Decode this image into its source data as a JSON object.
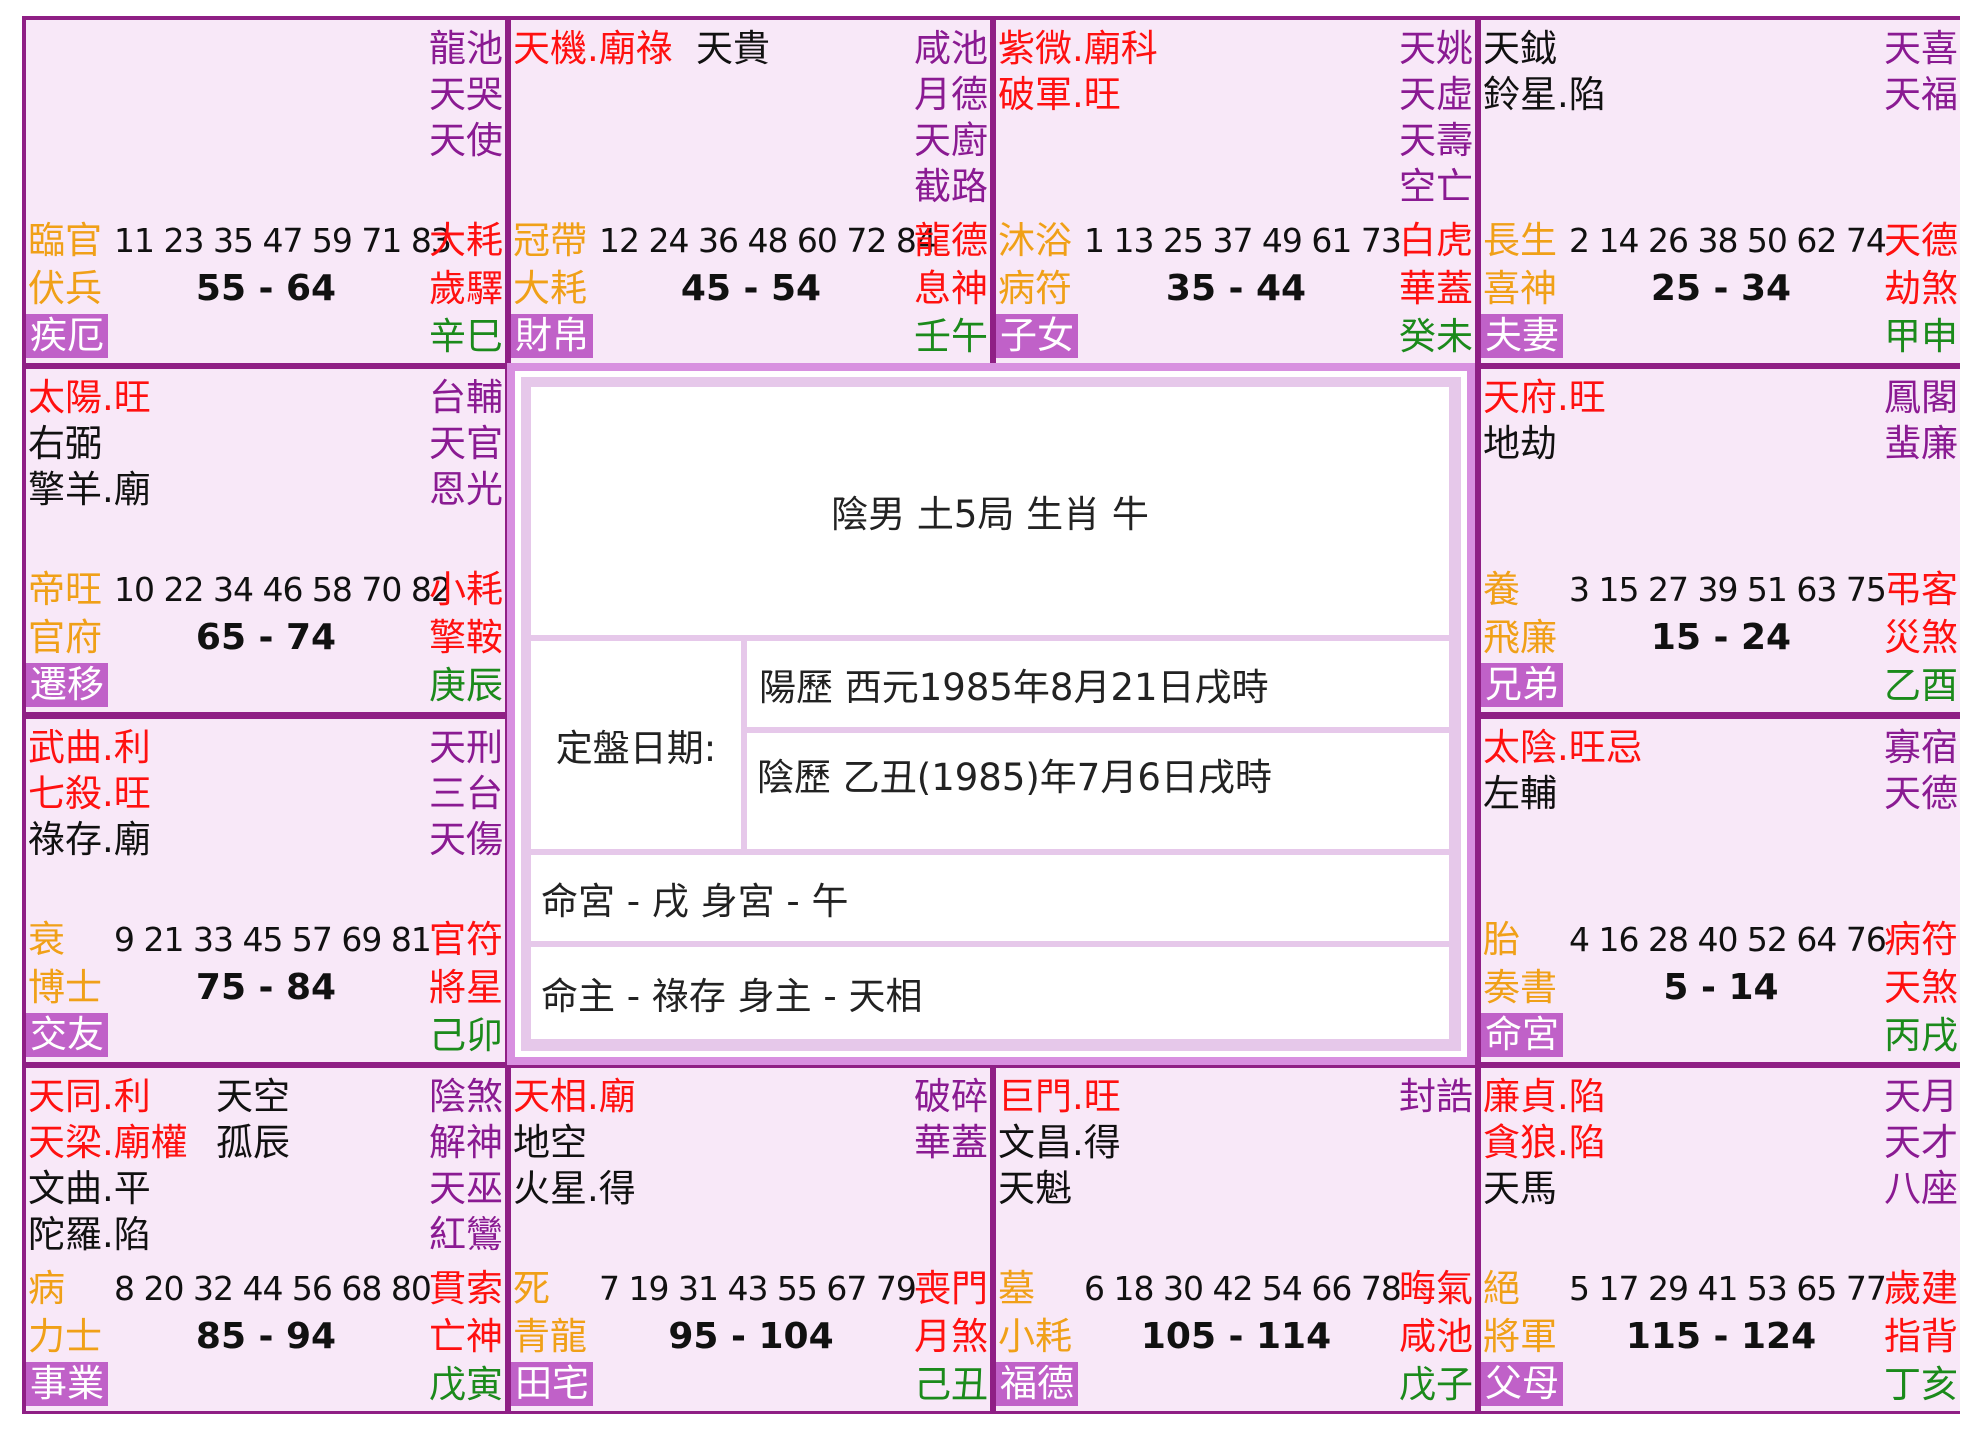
{
  "cells": [
    {
      "id": "si",
      "lt": [],
      "rt": [
        {
          "t": "龍池",
          "c": "pur"
        },
        {
          "t": "天哭",
          "c": "pur"
        },
        {
          "t": "天使",
          "c": "pur"
        }
      ],
      "stage": "臨官",
      "ages": "11 23 35 47 59 71 83",
      "r1": "大耗",
      "r1c": "red",
      "god": "伏兵",
      "range": "55 - 64",
      "r2": "歲驛",
      "r2c": "red",
      "palace": "疾厄",
      "branch": "辛巳"
    },
    {
      "id": "wu",
      "lt": [
        {
          "t": "天機.廟祿",
          "c": "red"
        }
      ],
      "lt2": [
        {
          "t": "天貴",
          "c": "blk"
        }
      ],
      "rt": [
        {
          "t": "咸池",
          "c": "pur"
        },
        {
          "t": "月德",
          "c": "pur"
        },
        {
          "t": "天廚",
          "c": "pur"
        },
        {
          "t": "截路",
          "c": "pur"
        }
      ],
      "stage": "冠帶",
      "ages": "12 24 36 48 60 72 84",
      "r1": "龍德",
      "r1c": "red",
      "god": "大耗",
      "range": "45 - 54",
      "r2": "息神",
      "r2c": "red",
      "palace": "財帛",
      "branch": "壬午"
    },
    {
      "id": "wei",
      "lt": [
        {
          "t": "紫微.廟科",
          "c": "red"
        },
        {
          "t": "破軍.旺",
          "c": "red"
        }
      ],
      "rt": [
        {
          "t": "天姚",
          "c": "pur"
        },
        {
          "t": "天虛",
          "c": "pur"
        },
        {
          "t": "天壽",
          "c": "pur"
        },
        {
          "t": "空亡",
          "c": "pur"
        }
      ],
      "stage": "沐浴",
      "ages": "1 13 25 37 49 61 73",
      "r1": "白虎",
      "r1c": "red",
      "god": "病符",
      "range": "35 - 44",
      "r2": "華蓋",
      "r2c": "red",
      "palace": "子女",
      "branch": "癸未"
    },
    {
      "id": "shen",
      "lt": [
        {
          "t": "天鉞",
          "c": "blk"
        },
        {
          "t": "鈴星.陷",
          "c": "blk"
        }
      ],
      "rt": [
        {
          "t": "天喜",
          "c": "pur"
        },
        {
          "t": "天福",
          "c": "pur"
        }
      ],
      "stage": "長生",
      "ages": "2 14 26 38 50 62 74",
      "r1": "天德",
      "r1c": "red",
      "god": "喜神",
      "range": "25 - 34",
      "r2": "劫煞",
      "r2c": "red",
      "palace": "夫妻",
      "branch": "甲申"
    },
    {
      "id": "chen",
      "lt": [
        {
          "t": "太陽.旺",
          "c": "red"
        },
        {
          "t": "右弼",
          "c": "blk"
        },
        {
          "t": "擎羊.廟",
          "c": "blk"
        }
      ],
      "rt": [
        {
          "t": "台輔",
          "c": "pur"
        },
        {
          "t": "天官",
          "c": "pur"
        },
        {
          "t": "恩光",
          "c": "pur"
        }
      ],
      "stage": "帝旺",
      "ages": "10 22 34 46 58 70 82",
      "r1": "小耗",
      "r1c": "red",
      "god": "官府",
      "range": "65 - 74",
      "r2": "擎鞍",
      "r2c": "red",
      "palace": "遷移",
      "branch": "庚辰"
    },
    {
      "id": "you",
      "lt": [
        {
          "t": "天府.旺",
          "c": "red"
        },
        {
          "t": "地劫",
          "c": "blk"
        }
      ],
      "rt": [
        {
          "t": "鳳閣",
          "c": "pur"
        },
        {
          "t": "蜚廉",
          "c": "pur"
        }
      ],
      "stage": "養",
      "ages": "3 15 27 39 51 63 75",
      "r1": "弔客",
      "r1c": "red",
      "god": "飛廉",
      "range": "15 - 24",
      "r2": "災煞",
      "r2c": "red",
      "palace": "兄弟",
      "branch": "乙酉"
    },
    {
      "id": "mao",
      "lt": [
        {
          "t": "武曲.利",
          "c": "red"
        },
        {
          "t": "七殺.旺",
          "c": "red"
        },
        {
          "t": "祿存.廟",
          "c": "blk"
        }
      ],
      "rt": [
        {
          "t": "天刑",
          "c": "pur"
        },
        {
          "t": "三台",
          "c": "pur"
        },
        {
          "t": "天傷",
          "c": "pur"
        }
      ],
      "stage": "衰",
      "ages": "9 21 33 45 57 69 81",
      "r1": "官符",
      "r1c": "red",
      "god": "博士",
      "range": "75 - 84",
      "r2": "將星",
      "r2c": "red",
      "palace": "交友",
      "branch": "己卯"
    },
    {
      "id": "xu",
      "lt": [
        {
          "t": "太陰.旺忌",
          "c": "red"
        },
        {
          "t": "左輔",
          "c": "blk"
        }
      ],
      "rt": [
        {
          "t": "寡宿",
          "c": "pur"
        },
        {
          "t": "天德",
          "c": "pur"
        }
      ],
      "stage": "胎",
      "ages": "4 16 28 40 52 64 76",
      "r1": "病符",
      "r1c": "red",
      "god": "奏書",
      "range": "5 - 14",
      "r2": "天煞",
      "r2c": "red",
      "palace": "命宮",
      "branch": "丙戌"
    },
    {
      "id": "yin",
      "lt": [
        {
          "t": "天同.利",
          "c": "red"
        },
        {
          "t": "天梁.廟權",
          "c": "red"
        },
        {
          "t": "文曲.平",
          "c": "blk"
        },
        {
          "t": "陀羅.陷",
          "c": "blk"
        }
      ],
      "lt2": [
        {
          "t": "天空",
          "c": "blk"
        },
        {
          "t": "孤辰",
          "c": "blk"
        }
      ],
      "rt": [
        {
          "t": "陰煞",
          "c": "pur"
        },
        {
          "t": "解神",
          "c": "pur"
        },
        {
          "t": "天巫",
          "c": "pur"
        },
        {
          "t": "紅鸞",
          "c": "pur"
        }
      ],
      "stage": "病",
      "ages": "8 20 32 44 56 68 80",
      "r1": "貫索",
      "r1c": "red",
      "god": "力士",
      "range": "85 - 94",
      "r2": "亡神",
      "r2c": "red",
      "palace": "事業",
      "branch": "戊寅"
    },
    {
      "id": "chou",
      "lt": [
        {
          "t": "天相.廟",
          "c": "red"
        },
        {
          "t": "地空",
          "c": "blk"
        },
        {
          "t": "火星.得",
          "c": "blk"
        }
      ],
      "rt": [
        {
          "t": "破碎",
          "c": "pur"
        },
        {
          "t": "華蓋",
          "c": "pur"
        }
      ],
      "stage": "死",
      "ages": "7 19 31 43 55 67 79",
      "r1": "喪門",
      "r1c": "red",
      "god": "青龍",
      "range": "95 - 104",
      "r2": "月煞",
      "r2c": "red",
      "palace": "田宅",
      "branch": "己丑"
    },
    {
      "id": "zi",
      "lt": [
        {
          "t": "巨門.旺",
          "c": "red"
        },
        {
          "t": "文昌.得",
          "c": "blk"
        },
        {
          "t": "天魁",
          "c": "blk"
        }
      ],
      "rt": [
        {
          "t": "封誥",
          "c": "pur"
        }
      ],
      "stage": "墓",
      "ages": "6 18 30 42 54 66 78",
      "r1": "晦氣",
      "r1c": "red",
      "god": "小耗",
      "range": "105 - 114",
      "r2": "咸池",
      "r2c": "red",
      "palace": "福德",
      "branch": "戊子"
    },
    {
      "id": "hai",
      "lt": [
        {
          "t": "廉貞.陷",
          "c": "red"
        },
        {
          "t": "貪狼.陷",
          "c": "red"
        },
        {
          "t": "天馬",
          "c": "blk"
        }
      ],
      "rt": [
        {
          "t": "天月",
          "c": "pur"
        },
        {
          "t": "天才",
          "c": "pur"
        },
        {
          "t": "八座",
          "c": "pur"
        }
      ],
      "stage": "絕",
      "ages": "5 17 29 41 53 65 77",
      "r1": "歲建",
      "r1c": "red",
      "god": "將軍",
      "range": "115 - 124",
      "r2": "指背",
      "r2c": "red",
      "palace": "父母",
      "branch": "丁亥"
    }
  ],
  "center": {
    "summary": "陰男 土5局 生肖 牛",
    "date_label": "定盤日期:",
    "solar": "陽歷 西元1985年8月21日戌時",
    "lunar": "陰歷 乙丑(1985)年7月6日戌時",
    "palace_line": "命宮 - 戌 身宮 - 午",
    "master_line": "命主 - 祿存 身主 - 天相"
  }
}
